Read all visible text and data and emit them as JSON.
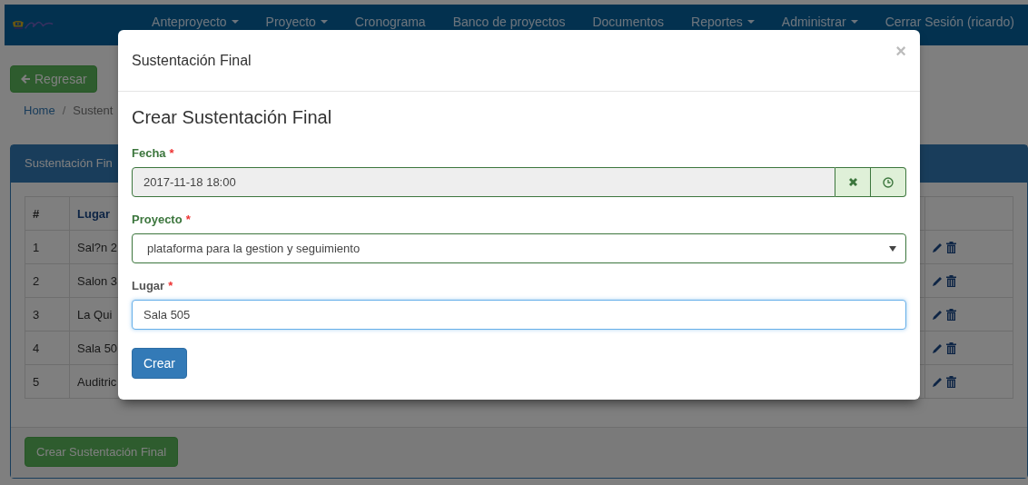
{
  "navbar": {
    "items": [
      {
        "label": "Anteproyecto",
        "dropdown": true
      },
      {
        "label": "Proyecto",
        "dropdown": true
      },
      {
        "label": "Cronograma",
        "dropdown": false
      },
      {
        "label": "Banco de proyectos",
        "dropdown": false
      },
      {
        "label": "Documentos",
        "dropdown": false
      },
      {
        "label": "Reportes",
        "dropdown": true
      },
      {
        "label": "Administrar",
        "dropdown": true
      },
      {
        "label": "Cerrar Sesión (ricardo)",
        "dropdown": false
      }
    ]
  },
  "back_button": "Regresar",
  "breadcrumb": {
    "separator": "/",
    "items": [
      "Home",
      "Sustent"
    ]
  },
  "panel": {
    "title": "Sustentación Fin",
    "table": {
      "columns": [
        "#",
        "Lugar"
      ],
      "rows": [
        {
          "number": "1",
          "lugar": "Sal?n 2"
        },
        {
          "number": "2",
          "lugar": "Salon 3"
        },
        {
          "number": "3",
          "lugar": "La Qui"
        },
        {
          "number": "4",
          "lugar": "Sala 50"
        },
        {
          "number": "5",
          "lugar": "Auditric"
        }
      ]
    },
    "footer_button": "Crear Sustentación Final"
  },
  "modal": {
    "title": "Sustentación Final",
    "close": "×",
    "heading": "Crear Sustentación Final",
    "fields": [
      {
        "kind": "datetime",
        "label": "Fecha",
        "required_mark": "*",
        "valid": true,
        "focused": false,
        "value": "2017-11-18 18:00"
      },
      {
        "kind": "select",
        "label": "Proyecto",
        "required_mark": "*",
        "valid": true,
        "focused": false,
        "value": "plataforma para la gestion y seguimiento"
      },
      {
        "kind": "text",
        "label": "Lugar",
        "required_mark": "*",
        "valid": false,
        "focused": true,
        "value": "Sala 505"
      }
    ],
    "submit": "Crear"
  }
}
